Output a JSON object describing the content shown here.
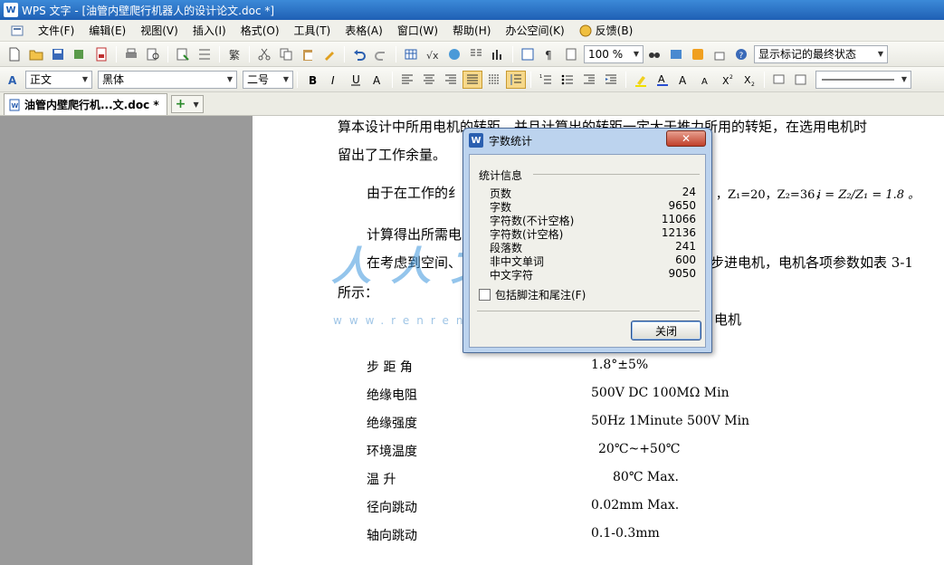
{
  "window": {
    "title": "WPS 文字 - [油管内壁爬行机器人的设计论文.doc *]",
    "app_icon": "W"
  },
  "menu": [
    "文件(F)",
    "编辑(E)",
    "视图(V)",
    "插入(I)",
    "格式(O)",
    "工具(T)",
    "表格(A)",
    "窗口(W)",
    "帮助(H)",
    "办公空间(K)",
    "反馈(B)"
  ],
  "toolbar": {
    "zoom": "100 %",
    "markup_mode": "显示标记的最终状态"
  },
  "format": {
    "style": "正文",
    "font": "黑体",
    "size": "二号"
  },
  "tabs": {
    "doc_tab": "油管内壁爬行机...文.doc *",
    "new_tab": "+"
  },
  "document": {
    "line1": "算本设计中所用电机的转距，并且计算出的转距一定大于推力所用的转矩，在选用电机时",
    "line2": "留出了工作余量。",
    "line3a": "由于在工作的纟",
    "line3b": "，Z₁=20，Z₂=36，",
    "formula": "i = Z₂/Z₁ = 1.8 。",
    "line4": "计算得出所需电",
    "line5a": "在考虑到空间、",
    "line5b": "步进电机，电机各项参数如表 3-1",
    "line6": "所示：",
    "line7": "电机",
    "specs": [
      {
        "label": "步 距 角",
        "value": "1.8°±5%"
      },
      {
        "label": "绝缘电阻",
        "value": "500V   DC   100MΩ   Min"
      },
      {
        "label": "绝缘强度",
        "value": "50Hz   1Minute   500V Min"
      },
      {
        "label": "环境温度",
        "value": "20℃~+50℃"
      },
      {
        "label": "温           升",
        "value": "80℃ Max."
      },
      {
        "label": "径向跳动",
        "value": "0.02mm Max."
      },
      {
        "label": "轴向跳动",
        "value": "0.1-0.3mm"
      }
    ]
  },
  "watermark": {
    "text": "人人文库",
    "url": "www.renrendoc.com"
  },
  "dialog": {
    "title": "字数统计",
    "group_label": "统计信息",
    "stats": [
      {
        "label": "页数",
        "value": "24"
      },
      {
        "label": "字数",
        "value": "9650"
      },
      {
        "label": "字符数(不计空格)",
        "value": "11066"
      },
      {
        "label": "字符数(计空格)",
        "value": "12136"
      },
      {
        "label": "段落数",
        "value": "241"
      },
      {
        "label": "非中文单词",
        "value": "600"
      },
      {
        "label": "中文字符",
        "value": "9050"
      }
    ],
    "checkbox_label": "包括脚注和尾注(F)",
    "close_button": "关闭",
    "close_x": "✕"
  },
  "colors": {
    "titlebar": "#2a6fc6",
    "dialog_frame": "#bcd3ee",
    "close_red": "#c0402a"
  }
}
